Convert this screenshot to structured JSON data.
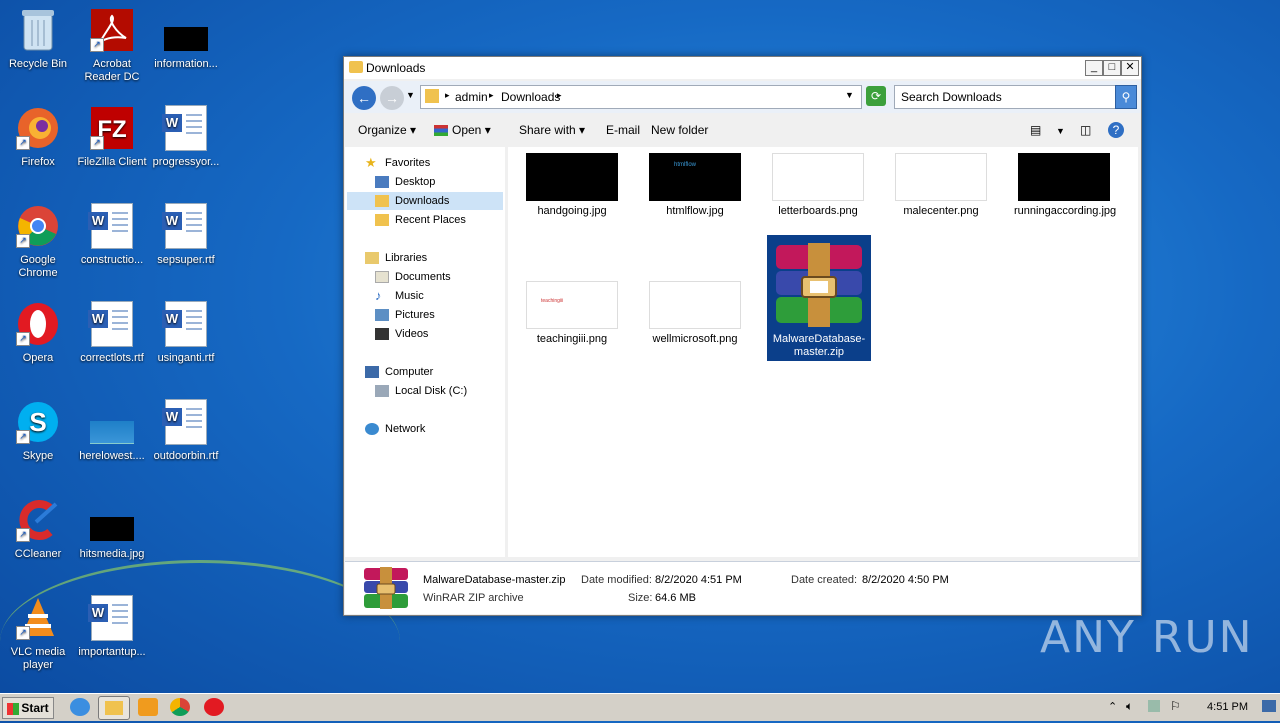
{
  "desktop_icons": [
    {
      "label": "Recycle Bin"
    },
    {
      "label": "Acrobat Reader DC"
    },
    {
      "label": "information..."
    },
    {
      "label": "Firefox"
    },
    {
      "label": "FileZilla Client"
    },
    {
      "label": "progressyor..."
    },
    {
      "label": "Google Chrome"
    },
    {
      "label": "constructio..."
    },
    {
      "label": "sepsuper.rtf"
    },
    {
      "label": "Opera"
    },
    {
      "label": "correctlots.rtf"
    },
    {
      "label": "usinganti.rtf"
    },
    {
      "label": "Skype"
    },
    {
      "label": "herelowest...."
    },
    {
      "label": "outdoorbin.rtf"
    },
    {
      "label": "CCleaner"
    },
    {
      "label": "hitsmedia.jpg"
    },
    {
      "label": "VLC media player"
    },
    {
      "label": "importantup..."
    }
  ],
  "window": {
    "title": "Downloads",
    "breadcrumb": [
      "admin",
      "Downloads"
    ],
    "search_placeholder": "Search Downloads",
    "toolbar": {
      "organize": "Organize",
      "open": "Open",
      "share_with": "Share with",
      "email": "E-mail",
      "new_folder": "New folder"
    },
    "navpane": {
      "favorites": "Favorites",
      "desktop": "Desktop",
      "downloads": "Downloads",
      "recent_places": "Recent Places",
      "libraries": "Libraries",
      "documents": "Documents",
      "music": "Music",
      "pictures": "Pictures",
      "videos": "Videos",
      "computer": "Computer",
      "local_disk": "Local Disk (C:)",
      "network": "Network"
    },
    "files": [
      {
        "name": "handgoing.jpg"
      },
      {
        "name": "htmlflow.jpg"
      },
      {
        "name": "letterboards.png"
      },
      {
        "name": "malecenter.png"
      },
      {
        "name": "runningaccording.jpg"
      },
      {
        "name": "teachingiii.png"
      },
      {
        "name": "wellmicrosoft.png"
      },
      {
        "name": "MalwareDatabase-master.zip"
      }
    ],
    "thumb_texts": {
      "htmlflow": "htmlflow",
      "teaching": "teachingiii"
    },
    "details": {
      "filename": "MalwareDatabase-master.zip",
      "type": "WinRAR ZIP archive",
      "date_modified_label": "Date modified:",
      "date_modified": "8/2/2020 4:51 PM",
      "size_label": "Size:",
      "size": "64.6 MB",
      "date_created_label": "Date created:",
      "date_created": "8/2/2020 4:50 PM"
    }
  },
  "taskbar": {
    "start_label": "Start",
    "clock": "4:51 PM"
  },
  "watermark": "ANY RUN",
  "colors": {
    "desktop_bg": "#1669c4",
    "selection_bg": "#0b3f8a",
    "nav_selected_bg": "#cde3f7"
  }
}
